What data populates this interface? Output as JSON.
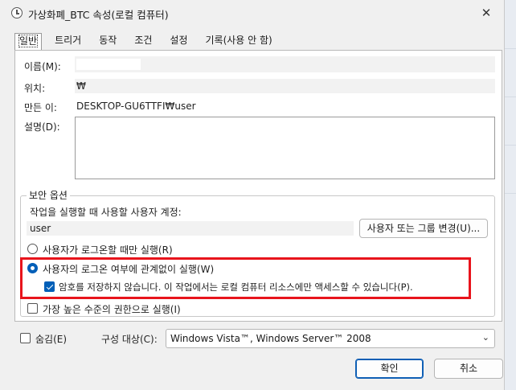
{
  "window": {
    "title": "가상화폐_BTC 속성(로컬 컴퓨터)",
    "close_symbol": "✕"
  },
  "tabs": [
    "일반",
    "트리거",
    "동작",
    "조건",
    "설정",
    "기록(사용 안 함)"
  ],
  "general": {
    "name_label": "이름(M):",
    "location_label": "위치:",
    "location_value": "₩",
    "author_label": "만든 이:",
    "author_value": "DESKTOP-GU6TTFI₩user",
    "description_label": "설명(D):"
  },
  "security": {
    "group_title": "보안 옵션",
    "run_as_prompt": "작업을 실행할 때 사용할 사용자 계정:",
    "run_as_user": "user",
    "change_user_button": "사용자 또는 그룹 변경(U)...",
    "option_logged_on": "사용자가 로그온할 때만 실행(R)",
    "option_whether_logged_on": "사용자의 로그온 여부에 관계없이 실행(W)",
    "option_do_not_store_password": "암호를 저장하지 않습니다. 이 작업에서는 로컬 컴퓨터 리소스에만 액세스할 수 있습니다(P).",
    "option_highest_privileges": "가장 높은 수준의 권한으로 실행(I)",
    "selected_option": "option_whether_logged_on",
    "do_not_store_password_checked": true,
    "highest_privileges_checked": false
  },
  "footer": {
    "hidden_label": "숨김(E)",
    "hidden_checked": false,
    "configure_for_label": "구성 대상(C):",
    "configure_for_value": "Windows Vista™, Windows Server™ 2008",
    "ok_button": "확인",
    "cancel_button": "취소"
  },
  "colors": {
    "accent": "#005fb8",
    "highlight_border": "#e8141c"
  }
}
